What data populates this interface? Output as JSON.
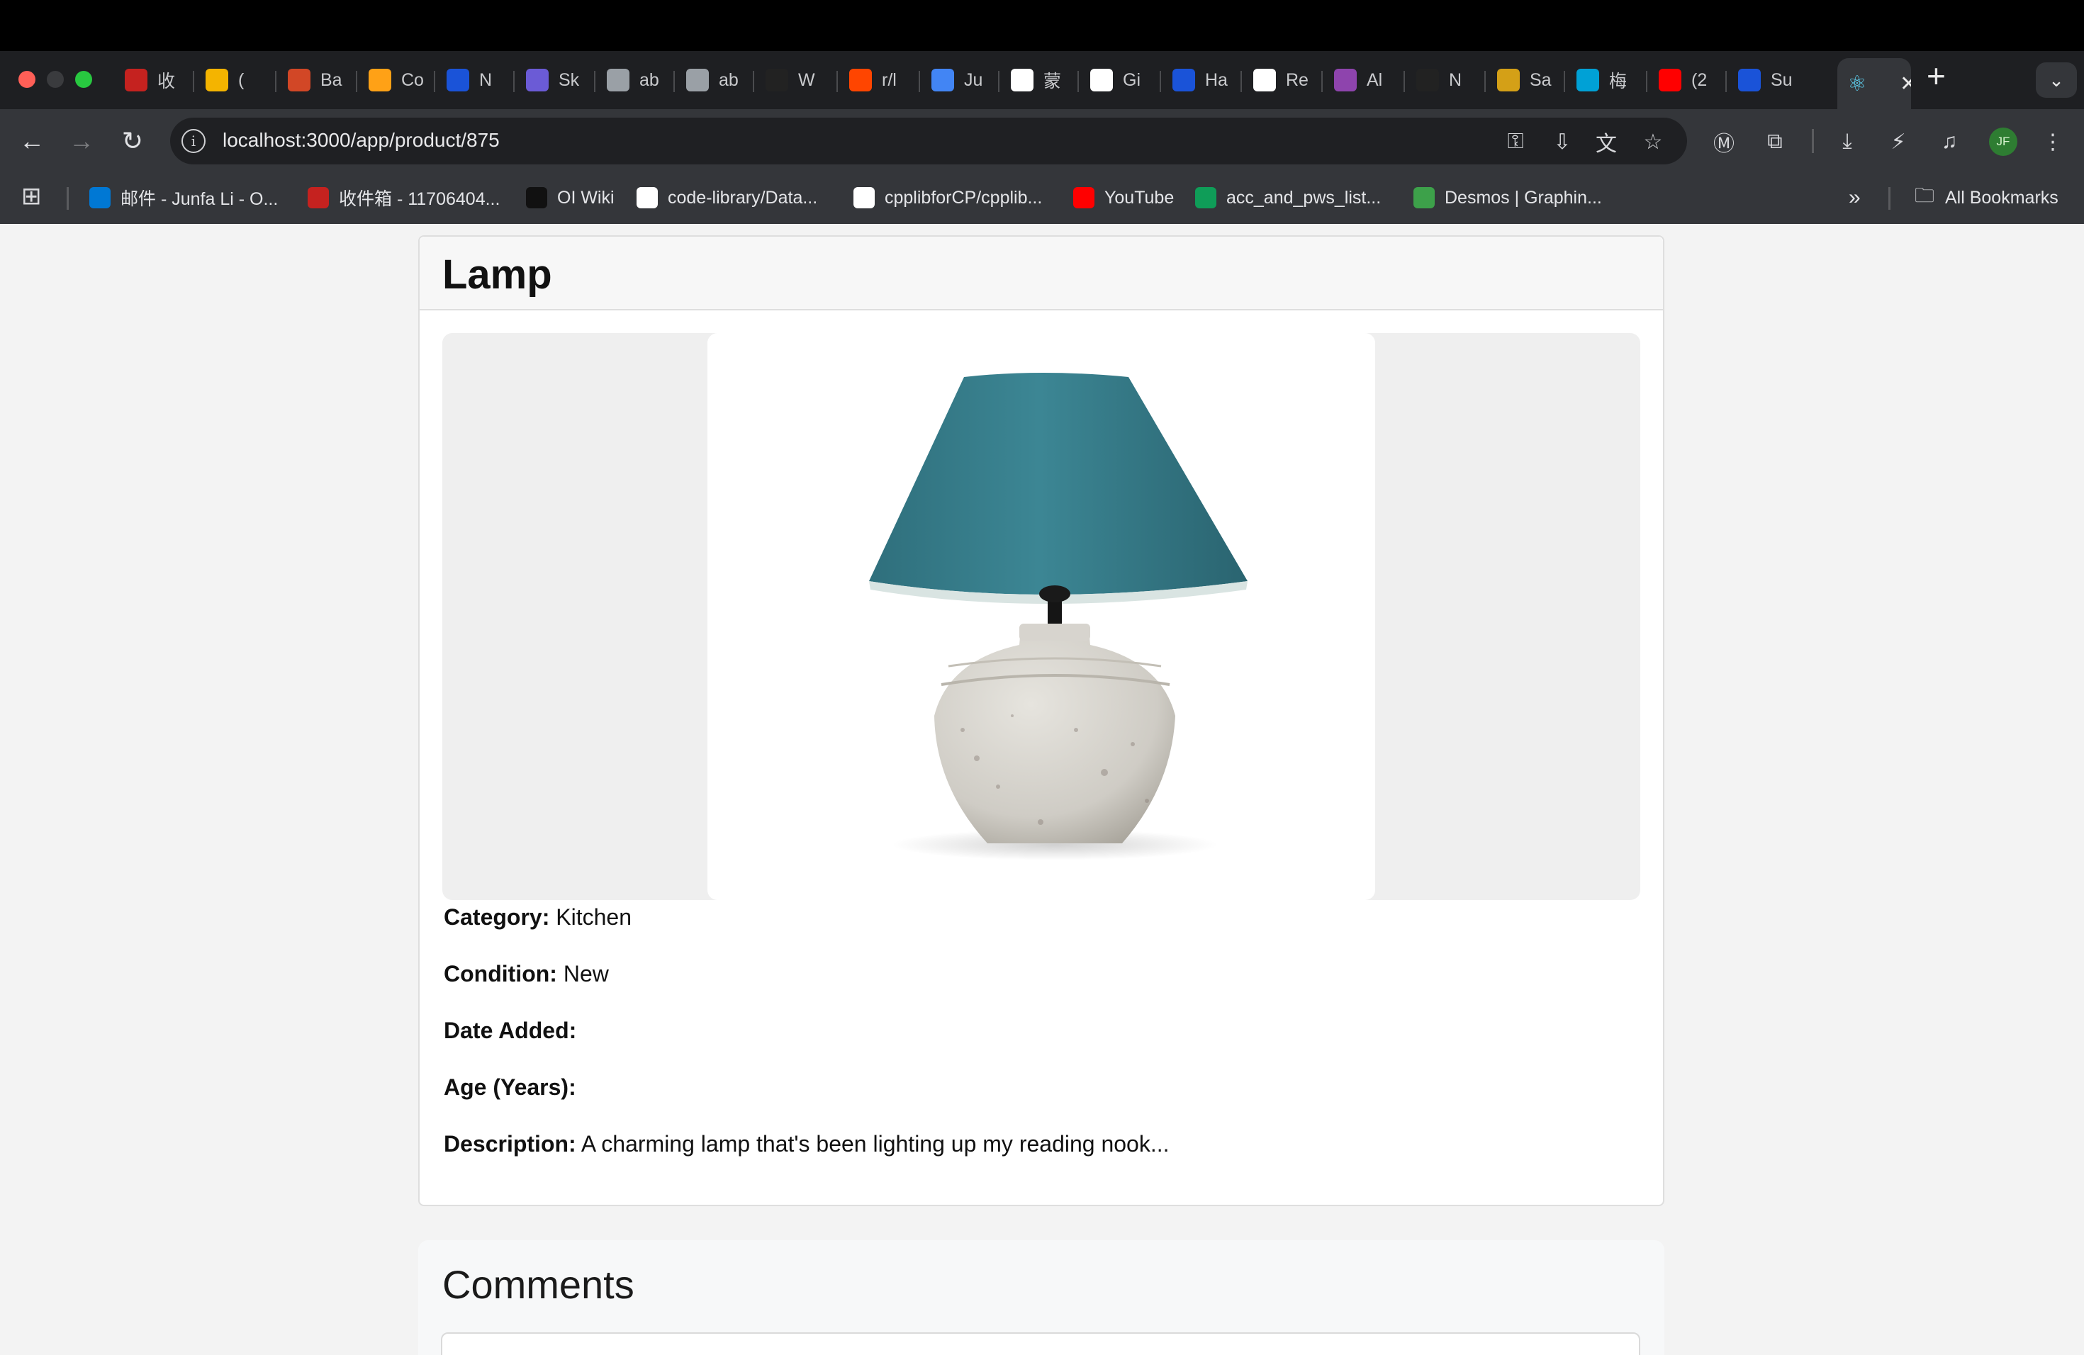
{
  "browser": {
    "tabs": [
      {
        "label": "收",
        "icon": "gmail-icon",
        "color": "#c5221f"
      },
      {
        "label": "(",
        "icon": "sunglasses-icon",
        "color": "#f4b400"
      },
      {
        "label": "Ba",
        "icon": "powerpoint-icon",
        "color": "#d24726"
      },
      {
        "label": "Co",
        "icon": "leetcode-icon",
        "color": "#ffa116"
      },
      {
        "label": "N",
        "icon": "c-circle-icon",
        "color": "#1a53d8"
      },
      {
        "label": "Sk",
        "icon": "sketch-icon",
        "color": "#6b5bd6"
      },
      {
        "label": "ab",
        "icon": "globe-icon",
        "color": "#9aa0a6"
      },
      {
        "label": "ab",
        "icon": "globe-icon",
        "color": "#9aa0a6"
      },
      {
        "label": "W",
        "icon": "openai-icon",
        "color": "#222222"
      },
      {
        "label": "r/l",
        "icon": "reddit-icon",
        "color": "#ff4500"
      },
      {
        "label": "Ju",
        "icon": "docs-icon",
        "color": "#4285f4"
      },
      {
        "label": "蒙",
        "icon": "info-icon",
        "color": "#ffffff"
      },
      {
        "label": "Gi",
        "icon": "github-icon",
        "color": "#ffffff"
      },
      {
        "label": "Ha",
        "icon": "c-circle-icon",
        "color": "#1a53d8"
      },
      {
        "label": "Re",
        "icon": "openai-icon",
        "color": "#ffffff"
      },
      {
        "label": "Al",
        "icon": "slash-icon",
        "color": "#8e44ad"
      },
      {
        "label": "N",
        "icon": "openai-icon",
        "color": "#222222"
      },
      {
        "label": "Sa",
        "icon": "flag-icon",
        "color": "#d4a017"
      },
      {
        "label": "梅",
        "icon": "bilibili-icon",
        "color": "#00a1d6"
      },
      {
        "label": "(2",
        "icon": "youtube-icon",
        "color": "#ff0000"
      },
      {
        "label": "Su",
        "icon": "c-circle-icon",
        "color": "#1a53d8"
      },
      {
        "label": "",
        "icon": "react-icon",
        "color": "#61dafb",
        "active": true
      }
    ],
    "url": "localhost:3000/app/product/875",
    "profile_initials": "JF",
    "bookmarks": [
      {
        "label": "邮件 - Junfa Li - O...",
        "icon": "outlook-icon",
        "color": "#0078d4"
      },
      {
        "label": "收件箱 - 11706404...",
        "icon": "gmail-icon",
        "color": "#c5221f"
      },
      {
        "label": "OI Wiki",
        "icon": "oiwiki-icon",
        "color": "#111111"
      },
      {
        "label": "code-library/Data...",
        "icon": "github-icon",
        "color": "#ffffff"
      },
      {
        "label": "cpplibforCP/cpplib...",
        "icon": "github-icon",
        "color": "#ffffff"
      },
      {
        "label": "YouTube",
        "icon": "youtube-icon",
        "color": "#ff0000"
      },
      {
        "label": "acc_and_pws_list...",
        "icon": "sheets-icon",
        "color": "#0f9d58"
      },
      {
        "label": "Desmos | Graphin...",
        "icon": "desmos-icon",
        "color": "#3da14a"
      }
    ],
    "all_bookmarks_label": "All Bookmarks"
  },
  "product": {
    "title": "Lamp",
    "fields": [
      {
        "label": "Category:",
        "value": "Kitchen"
      },
      {
        "label": "Condition:",
        "value": "New"
      },
      {
        "label": "Date Added:",
        "value": ""
      },
      {
        "label": "Age (Years):",
        "value": ""
      },
      {
        "label": "Description:",
        "value": "A charming lamp that's been lighting up my reading nook..."
      }
    ],
    "image_alt": "lamp-photo"
  },
  "comments": {
    "title": "Comments"
  }
}
